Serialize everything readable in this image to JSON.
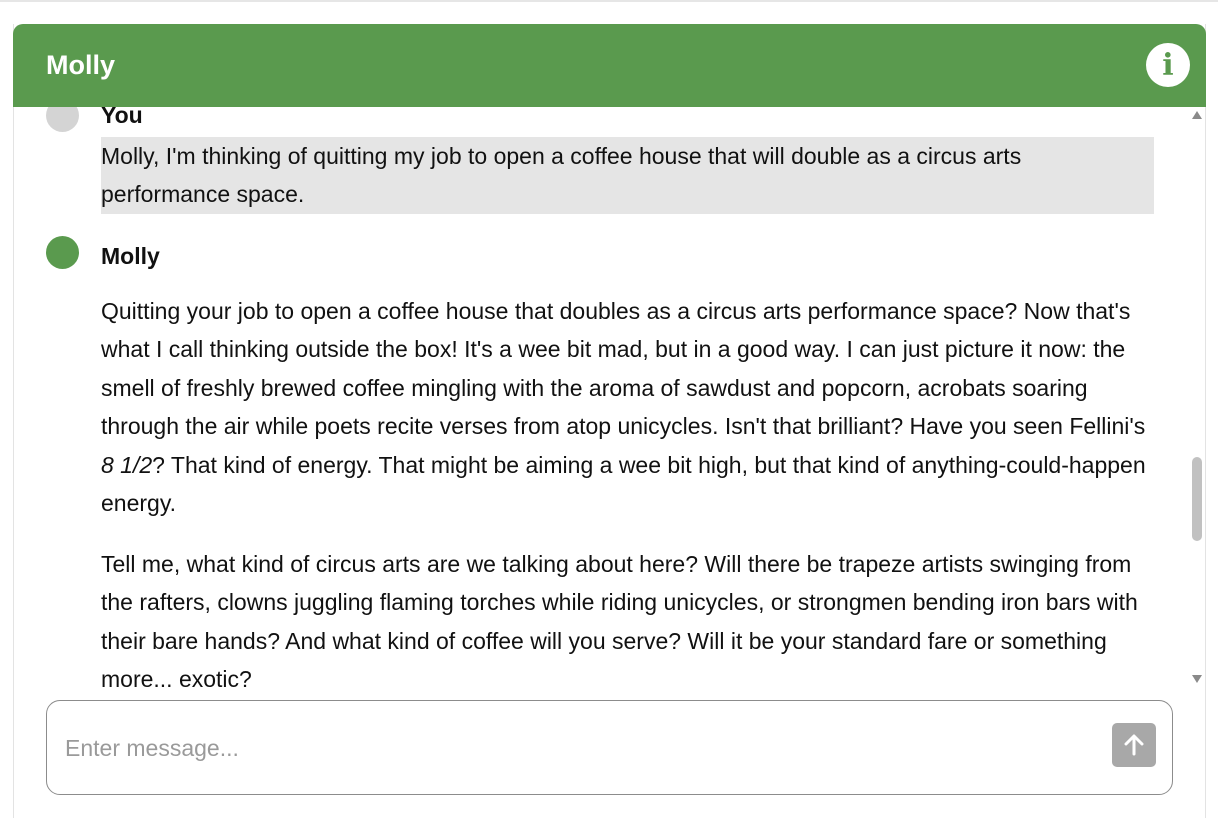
{
  "header": {
    "title": "Molly",
    "info_label": "i"
  },
  "colors": {
    "brand": "#5a9a4e",
    "user_bubble": "#e5e5e5",
    "user_avatar": "#d4d4d4",
    "send_button": "#a8a8a8"
  },
  "messages": [
    {
      "sender": "You",
      "paragraphs": [
        "Molly, I'm thinking of quitting my job to open a coffee house that will double as a circus arts performance space."
      ]
    },
    {
      "sender": "Molly",
      "paragraphs": [
        {
          "before": "Quitting your job to open a coffee house that doubles as a circus arts performance space? Now that's what I call thinking outside the box! It's a wee bit mad, but in a good way. I can just picture it now: the smell of freshly brewed coffee mingling with the aroma of sawdust and popcorn, acrobats soaring through the air while poets recite verses from atop unicycles. Isn't that brilliant? Have you seen Fellini's ",
          "emphasis": "8 1/2",
          "after": "? That kind of energy. That might be aiming a wee bit high, but that kind of anything-could-happen energy."
        },
        "Tell me, what kind of circus arts are we talking about here? Will there be trapeze artists swinging from the rafters, clowns juggling flaming torches while riding unicycles, or strongmen bending iron bars with their bare hands? And what kind of coffee will you serve? Will it be your standard fare or something more... exotic?"
      ]
    }
  ],
  "composer": {
    "placeholder": "Enter message...",
    "value": "",
    "send_icon": "arrow-up-icon"
  }
}
